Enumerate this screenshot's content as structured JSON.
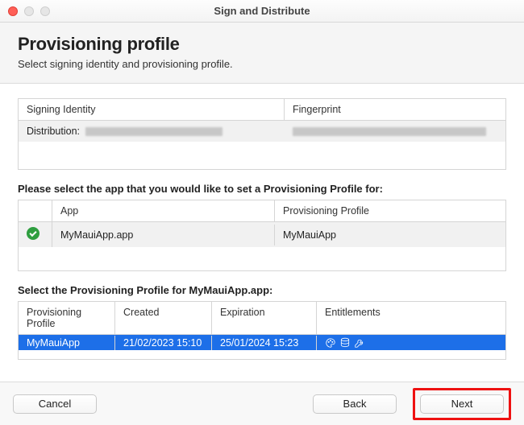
{
  "window": {
    "title": "Sign and Distribute"
  },
  "header": {
    "title": "Provisioning profile",
    "subtitle": "Select signing identity and provisioning profile."
  },
  "identity_table": {
    "columns": {
      "signing": "Signing Identity",
      "fingerprint": "Fingerprint"
    },
    "row": {
      "label": "Distribution:"
    }
  },
  "app_prompt": "Please select the app that you would like to set a Provisioning Profile for:",
  "app_table": {
    "columns": {
      "app": "App",
      "profile": "Provisioning Profile"
    },
    "row": {
      "app": "MyMauiApp.app",
      "profile": "MyMauiApp"
    }
  },
  "profile_prompt": "Select the Provisioning Profile for MyMauiApp.app:",
  "profile_table": {
    "columns": {
      "profile": "Provisioning Profile",
      "created": "Created",
      "expiration": "Expiration",
      "entitlements": "Entitlements"
    },
    "row": {
      "profile": "MyMauiApp",
      "created": "21/02/2023 15:10",
      "expiration": "25/01/2024 15:23"
    }
  },
  "buttons": {
    "cancel": "Cancel",
    "back": "Back",
    "next": "Next"
  }
}
